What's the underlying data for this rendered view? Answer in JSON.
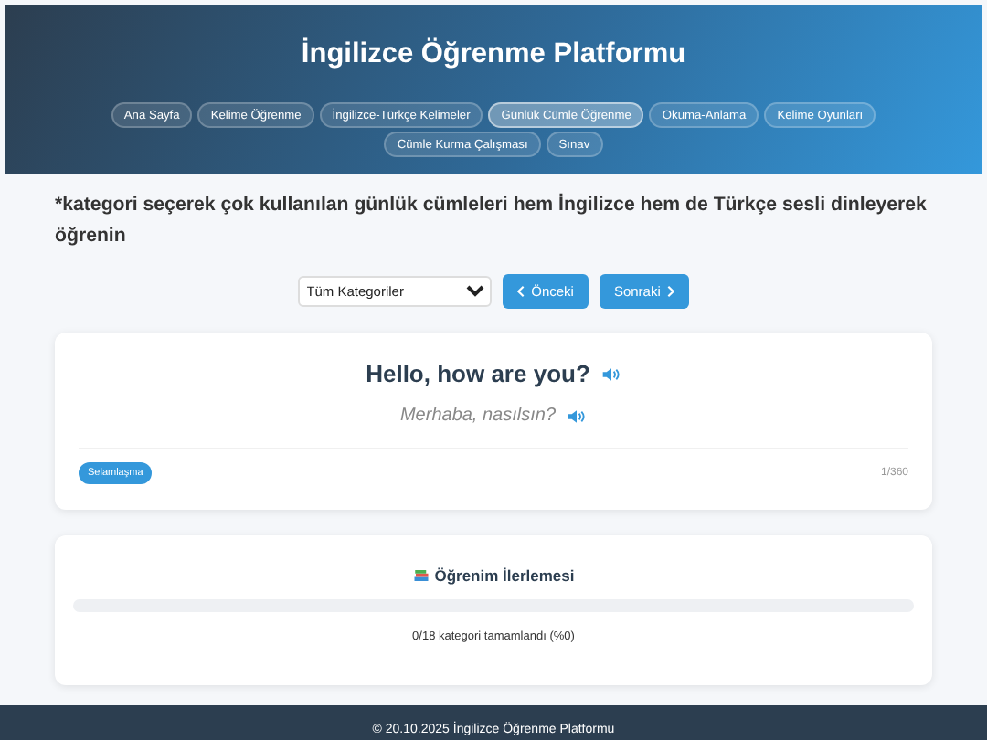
{
  "header": {
    "title": "İngilizce Öğrenme Platformu",
    "nav": [
      {
        "label": "Ana Sayfa",
        "selected": false
      },
      {
        "label": "Kelime Öğrenme",
        "selected": false
      },
      {
        "label": "İngilizce-Türkçe Kelimeler",
        "selected": false
      },
      {
        "label": "Günlük Cümle Öğrenme",
        "selected": true
      },
      {
        "label": "Okuma-Anlama",
        "selected": false
      },
      {
        "label": "Kelime Oyunları",
        "selected": false
      },
      {
        "label": "Cümle Kurma Çalışması",
        "selected": false
      },
      {
        "label": "Sınav",
        "selected": false
      }
    ]
  },
  "instruction": "*kategori seçerek çok kullanılan günlük cümleleri hem İngilizce hem de Türkçe sesli dinleyerek öğrenin",
  "controls": {
    "category": "Tüm Kategoriler",
    "prev": "Önceki",
    "next": "Sonraki"
  },
  "sentence": {
    "english": "Hello, how are you?",
    "turkish": "Merhaba, nasılsın?",
    "category": "Selamlaşma",
    "counter": "1/360"
  },
  "progress": {
    "title": "Öğrenim İlerlemesi",
    "level": 0,
    "summary": "0/18 kategori tamamlandı (%0)"
  },
  "footer": "© 20.10.2025 İngilizce Öğrenme Platformu"
}
